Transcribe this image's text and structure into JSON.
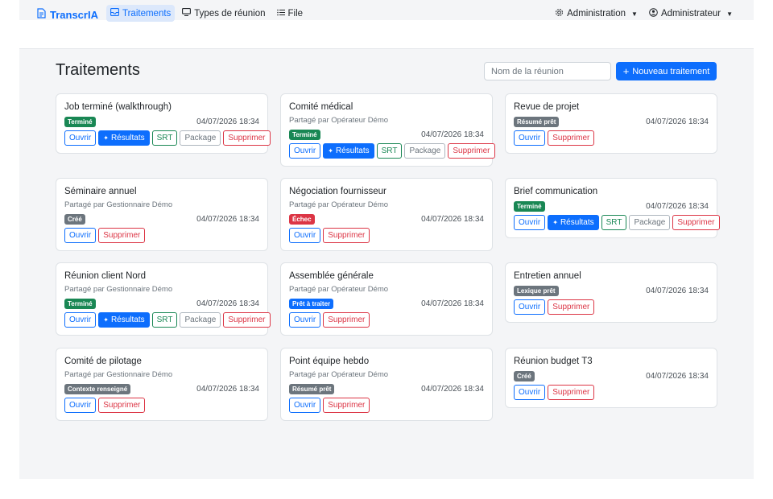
{
  "app": {
    "brand": "TranscrIA"
  },
  "nav": {
    "links": [
      {
        "label": "Traitements",
        "icon": "inbox-icon",
        "active": true
      },
      {
        "label": "Types de réunion",
        "icon": "monitor-icon",
        "active": false
      },
      {
        "label": "File",
        "icon": "list-icon",
        "active": false
      }
    ],
    "admin_menu": "Administration",
    "user_menu": "Administrateur"
  },
  "page": {
    "title": "Traitements",
    "search_placeholder": "Nom de la réunion",
    "new_button": "Nouveau traitement"
  },
  "labels": {
    "open": "Ouvrir",
    "results": "Résultats",
    "srt": "SRT",
    "package": "Package",
    "delete": "Supprimer"
  },
  "cards": [
    {
      "title": "Job terminé (walkthrough)",
      "shared": "",
      "status": "Terminé",
      "status_color": "#198754",
      "date": "04/07/2026 18:34",
      "full_actions": true
    },
    {
      "title": "Comité médical",
      "shared": "Partagé par Opérateur Démo",
      "status": "Terminé",
      "status_color": "#198754",
      "date": "04/07/2026 18:34",
      "full_actions": true
    },
    {
      "title": "Revue de projet",
      "shared": "",
      "status": "Résumé prêt",
      "status_color": "#6c757d",
      "date": "04/07/2026 18:34",
      "full_actions": false
    },
    {
      "title": "Séminaire annuel",
      "shared": "Partagé par Gestionnaire Démo",
      "status": "Créé",
      "status_color": "#6c757d",
      "date": "04/07/2026 18:34",
      "full_actions": false
    },
    {
      "title": "Négociation fournisseur",
      "shared": "Partagé par Opérateur Démo",
      "status": "Échec",
      "status_color": "#dc3545",
      "date": "04/07/2026 18:34",
      "full_actions": false
    },
    {
      "title": "Brief communication",
      "shared": "",
      "status": "Terminé",
      "status_color": "#198754",
      "date": "04/07/2026 18:34",
      "full_actions": true
    },
    {
      "title": "Réunion client Nord",
      "shared": "Partagé par Gestionnaire Démo",
      "status": "Terminé",
      "status_color": "#198754",
      "date": "04/07/2026 18:34",
      "full_actions": true
    },
    {
      "title": "Assemblée générale",
      "shared": "Partagé par Opérateur Démo",
      "status": "Prêt à traiter",
      "status_color": "#0d6efd",
      "date": "04/07/2026 18:34",
      "full_actions": false
    },
    {
      "title": "Entretien annuel",
      "shared": "",
      "status": "Lexique prêt",
      "status_color": "#6c757d",
      "date": "04/07/2026 18:34",
      "full_actions": false
    },
    {
      "title": "Comité de pilotage",
      "shared": "Partagé par Gestionnaire Démo",
      "status": "Contexte renseigné",
      "status_color": "#6c757d",
      "date": "04/07/2026 18:34",
      "full_actions": false
    },
    {
      "title": "Point équipe hebdo",
      "shared": "Partagé par Opérateur Démo",
      "status": "Résumé prêt",
      "status_color": "#6c757d",
      "date": "04/07/2026 18:34",
      "full_actions": false
    },
    {
      "title": "Réunion budget T3",
      "shared": "",
      "status": "Créé",
      "status_color": "#6c757d",
      "date": "04/07/2026 18:34",
      "full_actions": false
    }
  ]
}
